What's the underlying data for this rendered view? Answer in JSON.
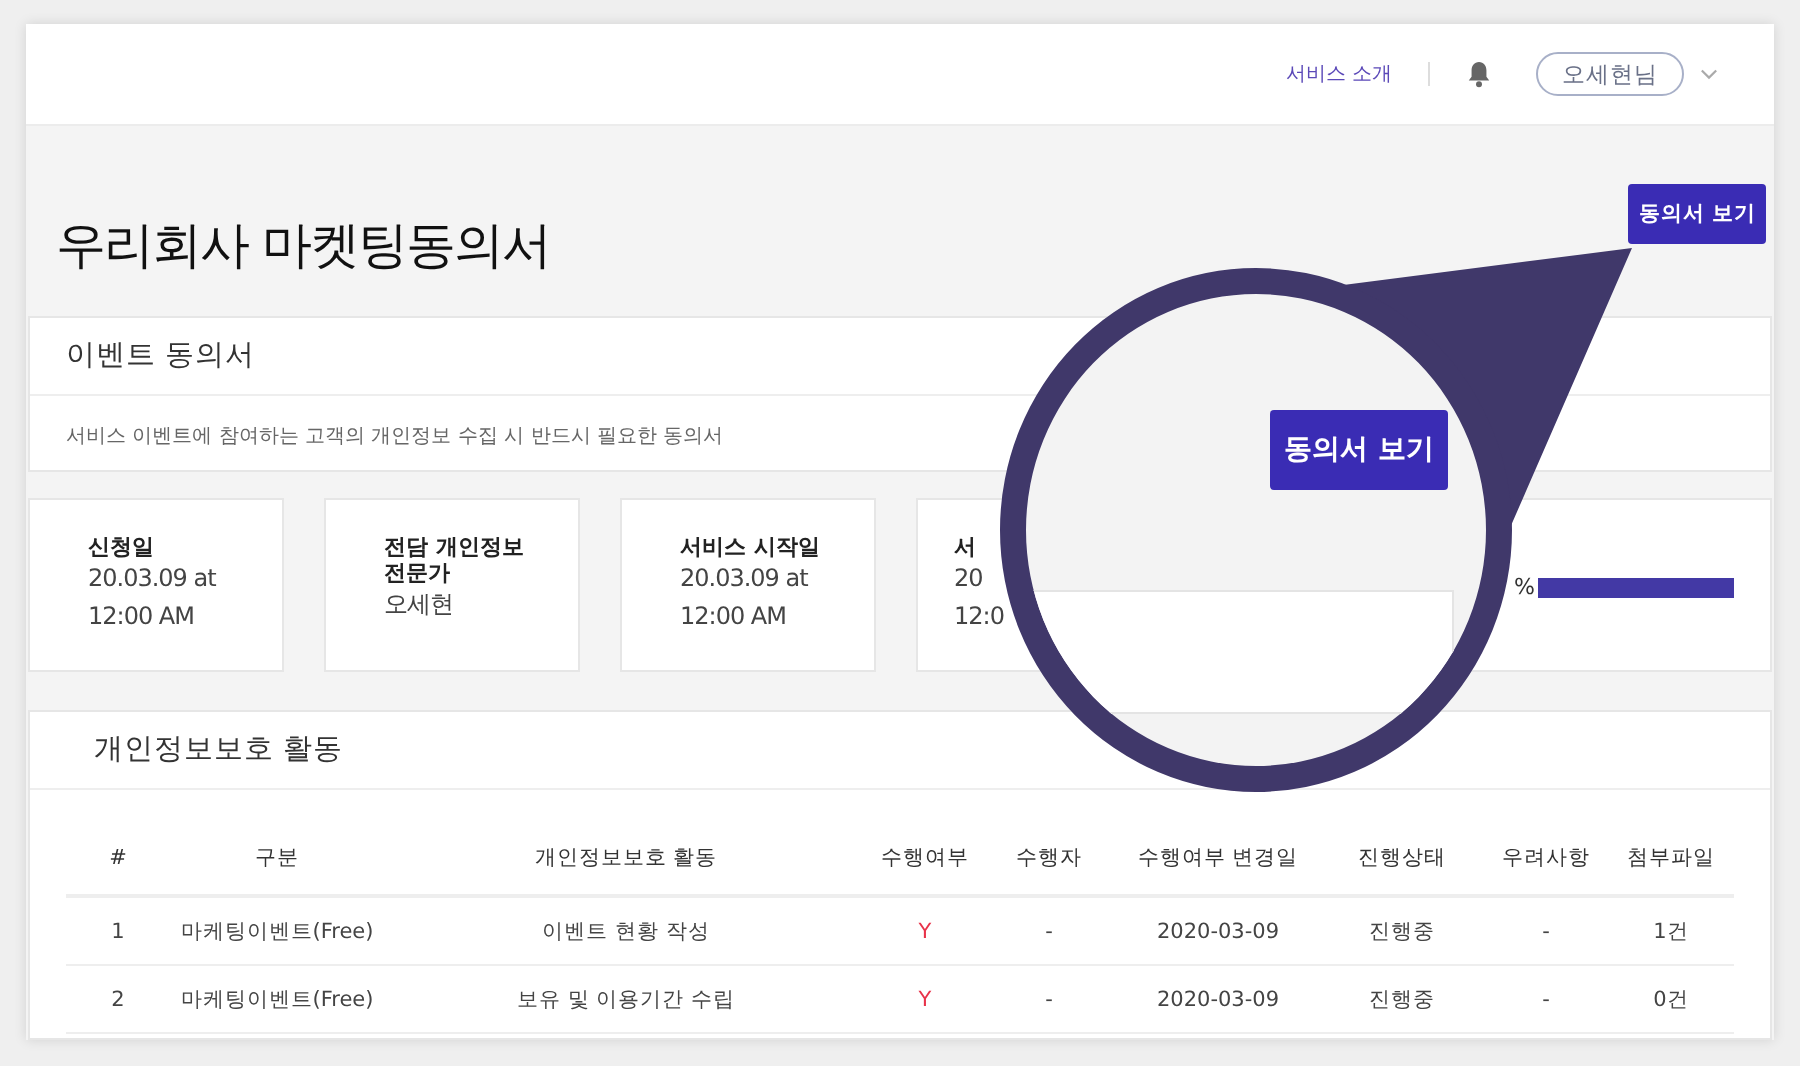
{
  "header": {
    "nav_link": "서비스 소개",
    "user": "오세현님"
  },
  "page_title": "우리회사 마켓팅동의서",
  "view_button": "동의서 보기",
  "event_card": {
    "title": "이벤트 동의서",
    "description": "서비스 이벤트에 참여하는 고객의 개인정보 수집 시 반드시 필요한 동의서"
  },
  "info_cards": [
    {
      "kind": "info",
      "label": "신청일",
      "lines": [
        "20.03.09 at",
        "12:00 AM"
      ]
    },
    {
      "kind": "info",
      "label": "전담 개인정보 전문가",
      "lines": [
        "오세현"
      ]
    },
    {
      "kind": "info",
      "label": "서비스 시작일",
      "lines": [
        "20.03.09 at",
        "12:00 AM"
      ]
    },
    {
      "kind": "info",
      "label": "서",
      "lines": [
        "20",
        "12:0"
      ]
    },
    {
      "kind": "progress",
      "reading": "%",
      "level": 1
    }
  ],
  "activity_table": {
    "title": "개인정보보호 활동",
    "columns": [
      "#",
      "구분",
      "개인정보보호 활동",
      "수행여부",
      "수행자",
      "수행여부 변경일",
      "진행상태",
      "우려사항",
      "첨부파일"
    ],
    "rows": [
      [
        "1",
        "마케팅이벤트(Free)",
        "이벤트 현황 작성",
        "Y",
        "-",
        "2020-03-09",
        "진행중",
        "-",
        "1건"
      ],
      [
        "2",
        "마케팅이벤트(Free)",
        "보유 및 이용기간 수립",
        "Y",
        "-",
        "2020-03-09",
        "진행중",
        "-",
        "0건"
      ]
    ]
  },
  "magnifier": {
    "button": "동의서 보기"
  }
}
